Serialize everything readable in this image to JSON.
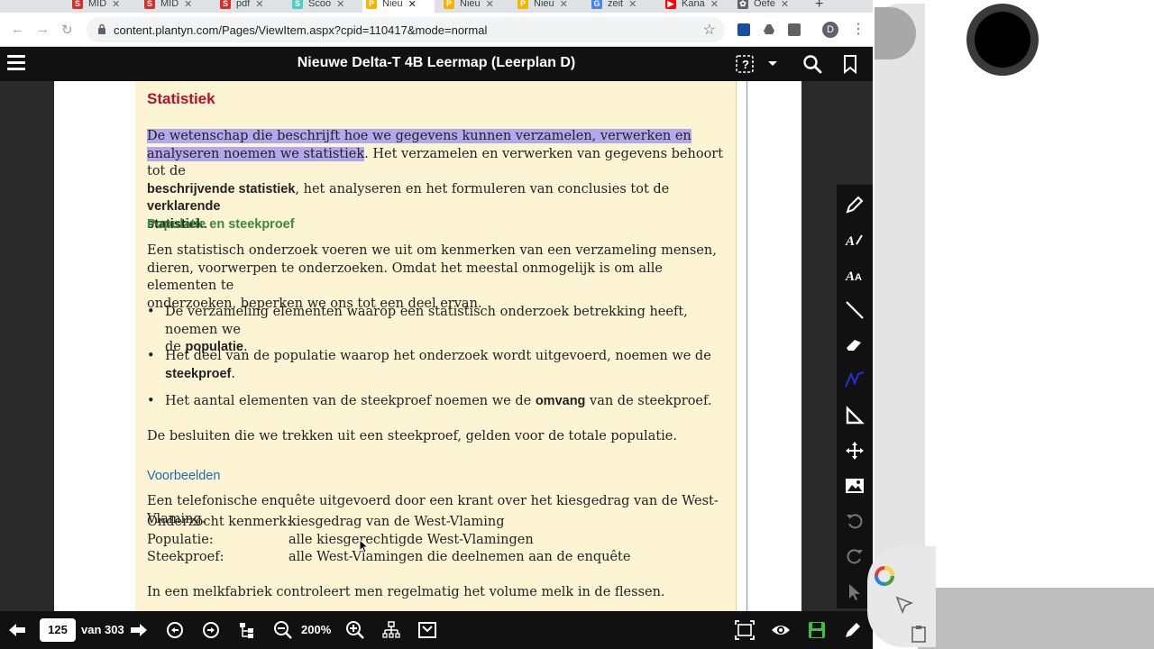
{
  "browser": {
    "tabs": [
      {
        "label": "MID",
        "color": "#d93025",
        "glyph": "S"
      },
      {
        "label": "MID",
        "color": "#d93025",
        "glyph": "S"
      },
      {
        "label": "pdf",
        "color": "#d93025",
        "glyph": "S"
      },
      {
        "label": "Scoo",
        "color": "#4ecdc4",
        "glyph": "S"
      },
      {
        "label": "Nieu",
        "color": "#f4b400",
        "glyph": "P",
        "active": true
      },
      {
        "label": "Nieu",
        "color": "#f4b400",
        "glyph": "P"
      },
      {
        "label": "Nieu",
        "color": "#f4b400",
        "glyph": "P"
      },
      {
        "label": "zeit",
        "color": "#4285f4",
        "glyph": "G"
      },
      {
        "label": "Kana",
        "color": "#ff0000",
        "glyph": "▶"
      },
      {
        "label": "Oefe",
        "color": "#5f6368",
        "glyph": "✿"
      }
    ],
    "url": "content.plantyn.com/Pages/ViewItem.aspx?cpid=110417&mode=normal",
    "profile_initial": "D"
  },
  "app": {
    "title": "Nieuwe Delta-T 4B Leermap (Leerplan D)"
  },
  "document": {
    "heading": "Statistiek",
    "intro_highlight_1": "De wetenschap die beschrijft hoe we gegevens kunnen verzamelen, verwerken en",
    "intro_highlight_2": "analyseren noemen we statistiek",
    "intro_rest_1": ". Het verzamelen en verwerken van gegevens behoort tot de",
    "intro_bold_1": "beschrijvende statistiek",
    "intro_rest_2": ", het analyseren en het formuleren van conclusies tot de",
    "intro_bold_2a": "verklarende",
    "intro_bold_2b": "statistiek",
    "intro_end": ".",
    "sub1": "Populatie en steekproef",
    "p1_l1": "Een statistisch onderzoek voeren we uit om kenmerken van een verzameling mensen,",
    "p1_l2": "dieren, voorwerpen te onderzoeken. Omdat het meestal onmogelijk is om alle elementen te",
    "p1_l3": "onderzoeken, beperken we ons tot een deel ervan.",
    "b1_l1": "De verzameling elementen waarop een statistisch onderzoek betrekking heeft, noemen we",
    "b1_l2a": "de ",
    "b1_bold": "populatie",
    "b1_end": ".",
    "b2_l1": "Het deel van de populatie waarop het onderzoek wordt uitgevoerd, noemen we de",
    "b2_bold": "steekproef",
    "b2_end": ".",
    "b3_a": "Het aantal elementen van de steekproef noemen we de ",
    "b3_bold": "omvang",
    "b3_b": " van de steekproef.",
    "p2": "De besluiten die we trekken uit een steekproef, gelden voor de totale populatie.",
    "sub2": "Voorbeelden",
    "ex1": "Een telefonische enquête uitgevoerd door een krant over het kiesgedrag van de West-Vlaming.",
    "table": [
      {
        "k": "Onderzocht kenmerk:",
        "v": "kiesgedrag van de West-Vlaming"
      },
      {
        "k": "Populatie:",
        "v": "alle kiesgerechtigde West-Vlamingen"
      },
      {
        "k": "Steekproef:",
        "v": "alle West-Vlamingen die deelnemen aan de enquête"
      }
    ],
    "ex2": "In een melkfabriek controleert men regelmatig het volume melk in de flessen."
  },
  "bottombar": {
    "page": "125",
    "of_label": "van 303",
    "zoom": "200%"
  },
  "colors": {
    "highlight": "#b3a8ee",
    "heading": "#b2132b",
    "sub_green": "#3a8a3a",
    "sub_blue": "#1a6bb5",
    "paper": "#fdf4d4",
    "save_green": "#3fbf3f"
  }
}
